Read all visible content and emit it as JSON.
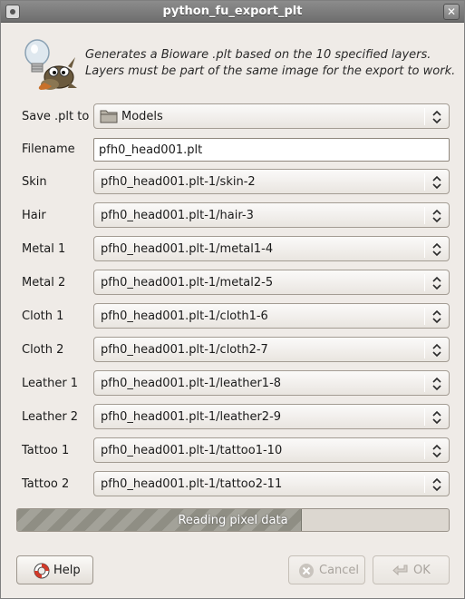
{
  "window": {
    "title": "python_fu_export_plt",
    "close_glyph": "✕"
  },
  "header": {
    "description_line1": "Generates a Bioware .plt based on the 10 specified layers.",
    "description_line2": "Layers must be part of the same image for the export to work.",
    "icon": "gimp-wilber-lightbulb-icon"
  },
  "form": {
    "save_to": {
      "label": "Save .plt to",
      "value": "Models",
      "icon": "folder-icon"
    },
    "filename": {
      "label": "Filename",
      "value": "pfh0_head001.plt"
    },
    "layers": [
      {
        "label": "Skin",
        "value": "pfh0_head001.plt-1/skin-2"
      },
      {
        "label": "Hair",
        "value": "pfh0_head001.plt-1/hair-3"
      },
      {
        "label": "Metal 1",
        "value": "pfh0_head001.plt-1/metal1-4"
      },
      {
        "label": "Metal 2",
        "value": "pfh0_head001.plt-1/metal2-5"
      },
      {
        "label": "Cloth 1",
        "value": "pfh0_head001.plt-1/cloth1-6"
      },
      {
        "label": "Cloth 2",
        "value": "pfh0_head001.plt-1/cloth2-7"
      },
      {
        "label": "Leather 1",
        "value": "pfh0_head001.plt-1/leather1-8"
      },
      {
        "label": "Leather 2",
        "value": "pfh0_head001.plt-1/leather2-9"
      },
      {
        "label": "Tattoo 1",
        "value": "pfh0_head001.plt-1/tattoo1-10"
      },
      {
        "label": "Tattoo 2",
        "value": "pfh0_head001.plt-1/tattoo2-11"
      }
    ]
  },
  "progress": {
    "text": "Reading pixel data",
    "fraction": 0.66
  },
  "buttons": {
    "help": {
      "label": "Help",
      "icon": "lifebuoy-icon"
    },
    "cancel": {
      "label": "Cancel",
      "icon": "cancel-icon",
      "disabled": true
    },
    "ok": {
      "label": "OK",
      "icon": "ok-arrow-icon",
      "disabled": true
    }
  },
  "colors": {
    "titlebar": "#7d7d7d",
    "background": "#efebe7",
    "progress_fill": "#8f8e84"
  }
}
